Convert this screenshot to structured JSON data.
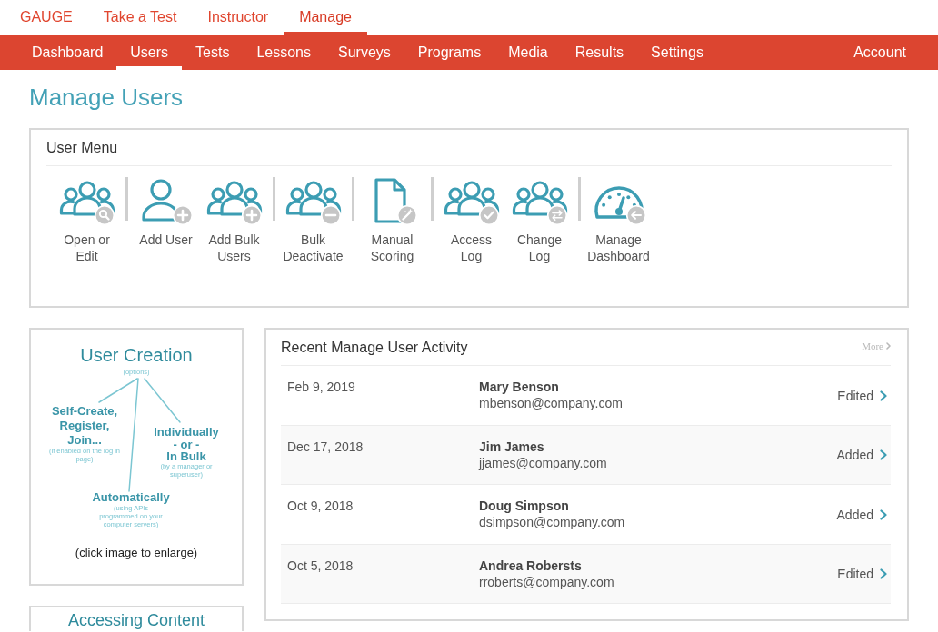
{
  "top_nav": [
    {
      "label": "GAUGE",
      "selected": false
    },
    {
      "label": "Take a Test",
      "selected": false
    },
    {
      "label": "Instructor",
      "selected": false
    },
    {
      "label": "Manage",
      "selected": true
    }
  ],
  "sub_nav": {
    "items": [
      {
        "label": "Dashboard",
        "selected": false
      },
      {
        "label": "Users",
        "selected": true
      },
      {
        "label": "Tests",
        "selected": false
      },
      {
        "label": "Lessons",
        "selected": false
      },
      {
        "label": "Surveys",
        "selected": false
      },
      {
        "label": "Programs",
        "selected": false
      },
      {
        "label": "Media",
        "selected": false
      },
      {
        "label": "Results",
        "selected": false
      },
      {
        "label": "Settings",
        "selected": false
      }
    ],
    "account_link": "Account"
  },
  "page_title": "Manage Users",
  "user_menu": {
    "title": "User Menu",
    "groups": [
      {
        "items": [
          {
            "label": "Open or Edit"
          }
        ]
      },
      {
        "items": [
          {
            "label": "Add User"
          },
          {
            "label": "Add Bulk Users"
          }
        ]
      },
      {
        "items": [
          {
            "label": "Bulk Deactivate"
          }
        ]
      },
      {
        "items": [
          {
            "label": "Manual Scoring"
          }
        ]
      },
      {
        "items": [
          {
            "label": "Access Log"
          },
          {
            "label": "Change Log"
          }
        ]
      },
      {
        "items": [
          {
            "label": "Manage Dashboard"
          }
        ]
      }
    ]
  },
  "user_creation_card": {
    "diagram": {
      "title": "User Creation",
      "subtitle": "(options)",
      "branches": [
        {
          "lines": [
            "Self-Create,",
            "Register,",
            "Join..."
          ],
          "note_lines": [
            "(if enabled on the log in",
            "page)"
          ]
        },
        {
          "lines": [
            "Individually",
            "- or -",
            "In Bulk"
          ],
          "note_lines": [
            "(by a manager or",
            "superuser)"
          ]
        },
        {
          "lines": [
            "Automatically"
          ],
          "note_lines": [
            "(using APIs",
            "programmed on your",
            "computer servers)"
          ]
        }
      ]
    },
    "caption": "(click image to enlarge)"
  },
  "accessing_content_card": {
    "title": "Accessing Content"
  },
  "recent_activity": {
    "title": "Recent Manage User Activity",
    "more_link": "More",
    "rows": [
      {
        "date": "Feb 9, 2019",
        "name": "Mary Benson",
        "email": "mbenson@company.com",
        "action": "Edited"
      },
      {
        "date": "Dec 17, 2018",
        "name": "Jim James",
        "email": "jjames@company.com",
        "action": "Added"
      },
      {
        "date": "Oct 9, 2018",
        "name": "Doug Simpson",
        "email": "dsimpson@company.com",
        "action": "Added"
      },
      {
        "date": "Oct 5, 2018",
        "name": "Andrea Robersts",
        "email": "rroberts@company.com",
        "action": "Edited"
      }
    ]
  }
}
